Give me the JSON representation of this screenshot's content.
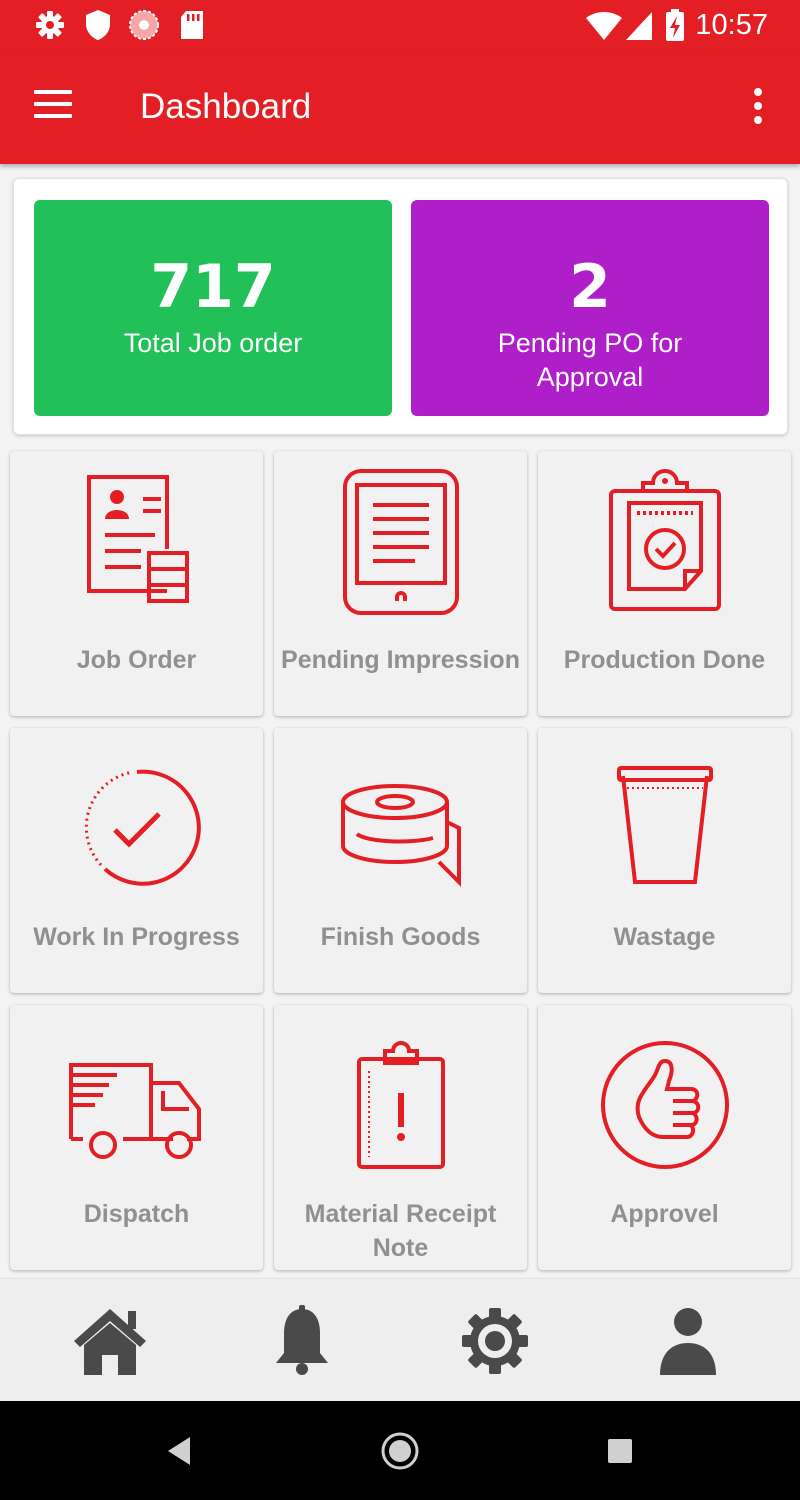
{
  "status_bar": {
    "time": "10:57",
    "icons": [
      "settings-icon",
      "shield-icon",
      "pinwheel-icon",
      "sd-card-icon",
      "wifi-icon",
      "cell-signal-icon",
      "battery-charging-icon"
    ]
  },
  "app_bar": {
    "title": "Dashboard",
    "menu_icon": "hamburger-menu-icon",
    "overflow_icon": "more-vert-icon"
  },
  "stats": [
    {
      "value": "717",
      "label": "Total Job order",
      "color": "#21c058"
    },
    {
      "value": "2",
      "label": "Pending PO for Approval",
      "color": "#ae1ec9"
    }
  ],
  "tiles": [
    {
      "label": "Job Order",
      "icon": "job-order-icon"
    },
    {
      "label": "Pending Impression",
      "icon": "tablet-document-icon"
    },
    {
      "label": "Production Done",
      "icon": "clipboard-check-icon"
    },
    {
      "label": "Work In Progress",
      "icon": "progress-check-icon"
    },
    {
      "label": "Finish Goods",
      "icon": "tape-roll-icon"
    },
    {
      "label": "Wastage",
      "icon": "waste-bin-icon"
    },
    {
      "label": "Dispatch",
      "icon": "delivery-truck-icon"
    },
    {
      "label": "Material Receipt Note",
      "icon": "clipboard-alert-icon"
    },
    {
      "label": "Approvel",
      "icon": "thumbs-up-icon"
    }
  ],
  "bottom_nav": [
    "home-icon",
    "notification-bell-icon",
    "settings-gear-icon",
    "profile-icon"
  ],
  "system_nav": [
    "back-icon",
    "home-circle-icon",
    "recents-icon"
  ],
  "colors": {
    "primary": "#e31e24",
    "tile_background": "#f1f1f1",
    "tile_label": "#909090",
    "nav_icon": "#4a4a4a"
  }
}
